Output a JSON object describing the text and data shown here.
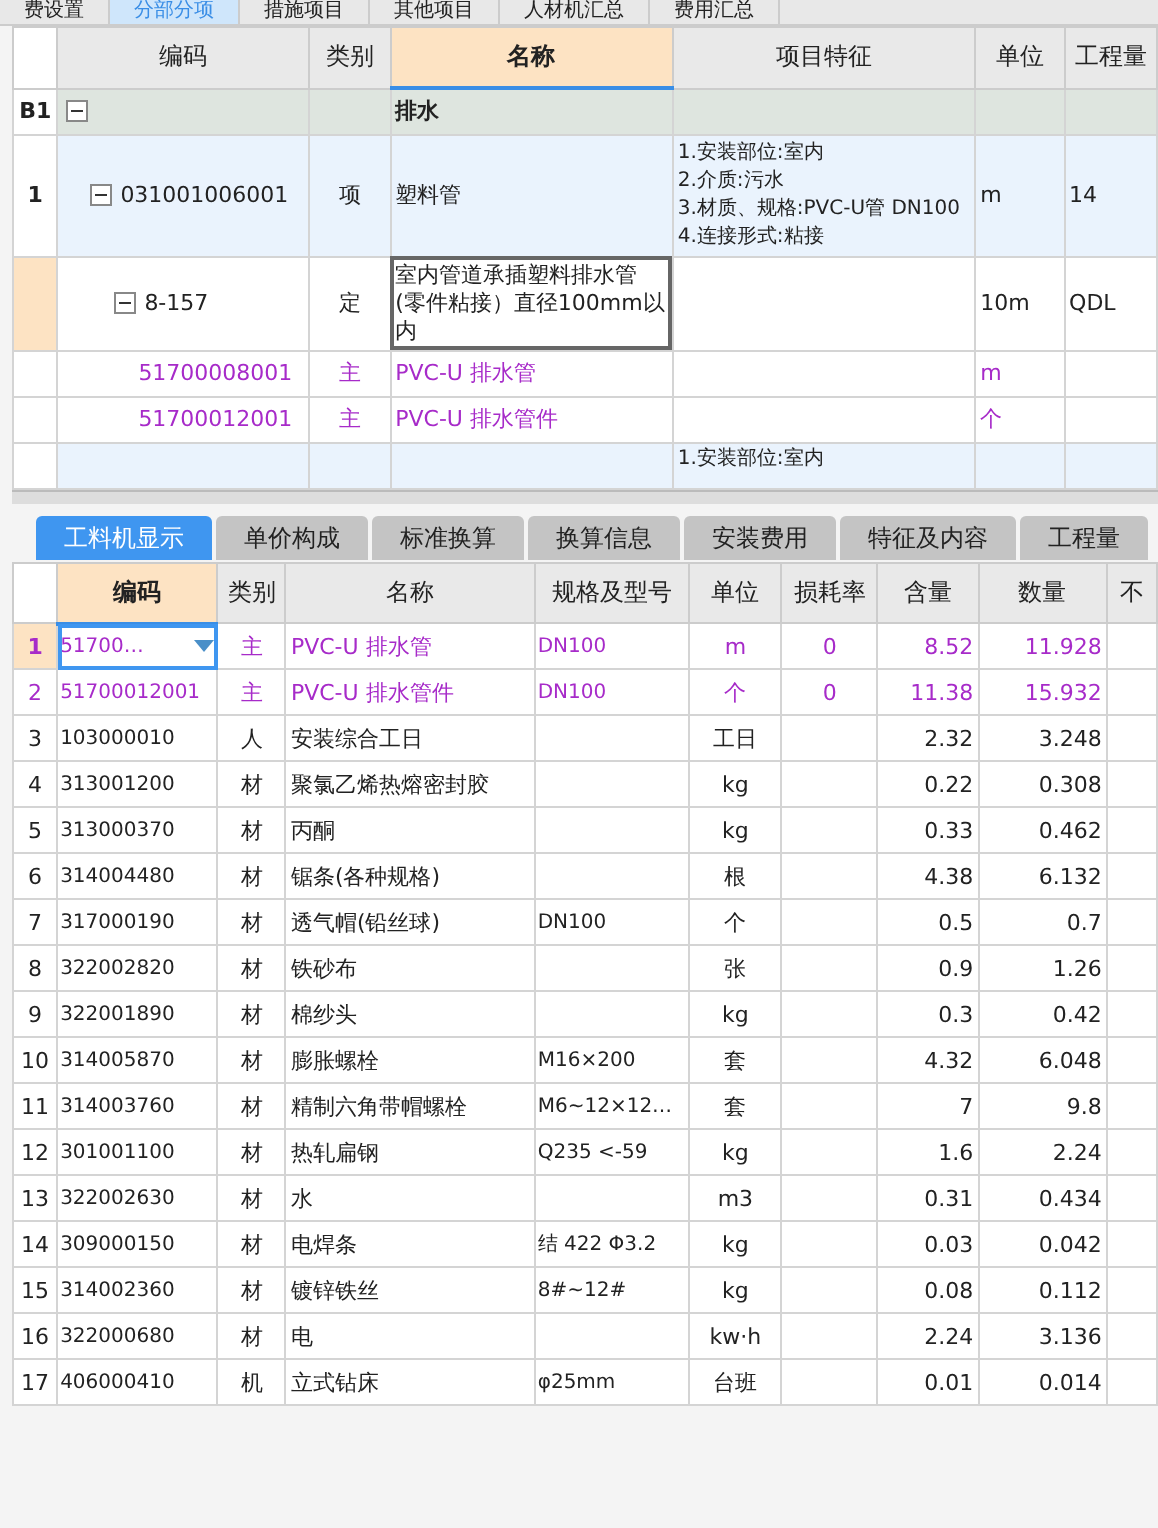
{
  "top_tabs": [
    {
      "label": "费设置",
      "selected": false
    },
    {
      "label": "分部分项",
      "selected": true
    },
    {
      "label": "措施项目",
      "selected": false
    },
    {
      "label": "其他项目",
      "selected": false
    },
    {
      "label": "人材机汇总",
      "selected": false
    },
    {
      "label": "费用汇总",
      "selected": false
    }
  ],
  "upper": {
    "columns": [
      {
        "label": "编码",
        "selected": false
      },
      {
        "label": "类别",
        "selected": false
      },
      {
        "label": "名称",
        "selected": true
      },
      {
        "label": "项目特征",
        "selected": false
      },
      {
        "label": "单位",
        "selected": false
      },
      {
        "label": "工程量",
        "selected": false
      }
    ],
    "rows": [
      {
        "row_no": "B1",
        "name": "排水",
        "kind": "section",
        "expanded": true,
        "selected": false,
        "children": [
          {
            "row_no": "1",
            "code": "031001006001",
            "type": "项",
            "name": "塑料管",
            "features": [
              "1.安装部位:室内",
              "2.介质:污水",
              "3.材质、规格:PVC-U管 DN100",
              "4.连接形式:粘接"
            ],
            "unit": "m",
            "qty": "14",
            "kind": "item",
            "expanded": true,
            "selected": false,
            "children": [
              {
                "code": "8-157",
                "type": "定",
                "name": "室内管道承插塑料排水管(零件粘接）直径100mm以内",
                "unit": "10m",
                "qty": "QDL",
                "kind": "quota",
                "expanded": true,
                "selected": true,
                "children": [
                  {
                    "code": "51700008001",
                    "type": "主",
                    "name": "PVC-U 排水管",
                    "unit": "m",
                    "kind": "main",
                    "selected": false
                  },
                  {
                    "code": "51700012001",
                    "type": "主",
                    "name": "PVC-U 排水管件",
                    "unit": "个",
                    "kind": "main",
                    "selected": false
                  }
                ]
              }
            ]
          },
          {
            "features": [
              "1.安装部位:室内"
            ],
            "kind": "partial",
            "selected": false
          }
        ]
      }
    ]
  },
  "lower_tabs": [
    {
      "label": "工料机显示",
      "selected": true
    },
    {
      "label": "单价构成",
      "selected": false
    },
    {
      "label": "标准换算",
      "selected": false
    },
    {
      "label": "换算信息",
      "selected": false
    },
    {
      "label": "安装费用",
      "selected": false
    },
    {
      "label": "特征及内容",
      "selected": false
    },
    {
      "label": "工程量",
      "selected": false
    }
  ],
  "lower": {
    "columns": [
      {
        "label": "编码",
        "selected": true
      },
      {
        "label": "类别",
        "selected": false
      },
      {
        "label": "名称",
        "selected": false
      },
      {
        "label": "规格及型号",
        "selected": false
      },
      {
        "label": "单位",
        "selected": false
      },
      {
        "label": "损耗率",
        "selected": false
      },
      {
        "label": "含量",
        "selected": false
      },
      {
        "label": "数量",
        "selected": false
      },
      {
        "label": "不",
        "selected": false
      }
    ],
    "rows": [
      {
        "no": "1",
        "code": "51700…",
        "type": "主",
        "name": "PVC-U 排水管",
        "spec": "DN100",
        "unit": "m",
        "loss": "0",
        "content": "8.52",
        "qty": "11.928",
        "kind": "main",
        "selected": true
      },
      {
        "no": "2",
        "code": "51700012001",
        "type": "主",
        "name": "PVC-U 排水管件",
        "spec": "DN100",
        "unit": "个",
        "loss": "0",
        "content": "11.38",
        "qty": "15.932",
        "kind": "main",
        "selected": false
      },
      {
        "no": "3",
        "code": "103000010",
        "type": "人",
        "name": "安装综合工日",
        "unit": "工日",
        "content": "2.32",
        "qty": "3.248",
        "kind": "normal",
        "selected": false
      },
      {
        "no": "4",
        "code": "313001200",
        "type": "材",
        "name": "聚氯乙烯热熔密封胶",
        "unit": "kg",
        "content": "0.22",
        "qty": "0.308",
        "kind": "normal",
        "selected": false
      },
      {
        "no": "5",
        "code": "313000370",
        "type": "材",
        "name": "丙酮",
        "unit": "kg",
        "content": "0.33",
        "qty": "0.462",
        "kind": "normal",
        "selected": false
      },
      {
        "no": "6",
        "code": "314004480",
        "type": "材",
        "name": "锯条(各种规格)",
        "unit": "根",
        "content": "4.38",
        "qty": "6.132",
        "kind": "normal",
        "selected": false
      },
      {
        "no": "7",
        "code": "317000190",
        "type": "材",
        "name": "透气帽(铅丝球)",
        "spec": "DN100",
        "unit": "个",
        "content": "0.5",
        "qty": "0.7",
        "kind": "normal",
        "selected": false
      },
      {
        "no": "8",
        "code": "322002820",
        "type": "材",
        "name": "铁砂布",
        "unit": "张",
        "content": "0.9",
        "qty": "1.26",
        "kind": "normal",
        "selected": false
      },
      {
        "no": "9",
        "code": "322001890",
        "type": "材",
        "name": "棉纱头",
        "unit": "kg",
        "content": "0.3",
        "qty": "0.42",
        "kind": "normal",
        "selected": false
      },
      {
        "no": "10",
        "code": "314005870",
        "type": "材",
        "name": "膨胀螺栓",
        "spec": "M16×200",
        "unit": "套",
        "content": "4.32",
        "qty": "6.048",
        "kind": "normal",
        "selected": false
      },
      {
        "no": "11",
        "code": "314003760",
        "type": "材",
        "name": "精制六角带帽螺栓",
        "spec": "M6~12×12…",
        "unit": "套",
        "content": "7",
        "qty": "9.8",
        "kind": "normal",
        "selected": false
      },
      {
        "no": "12",
        "code": "301001100",
        "type": "材",
        "name": "热轧扁钢",
        "spec": "Q235 <-59",
        "unit": "kg",
        "content": "1.6",
        "qty": "2.24",
        "kind": "normal",
        "selected": false
      },
      {
        "no": "13",
        "code": "322002630",
        "type": "材",
        "name": "水",
        "unit": "m3",
        "content": "0.31",
        "qty": "0.434",
        "kind": "normal",
        "selected": false
      },
      {
        "no": "14",
        "code": "309000150",
        "type": "材",
        "name": "电焊条",
        "spec": "结 422 Φ3.2",
        "unit": "kg",
        "content": "0.03",
        "qty": "0.042",
        "kind": "normal",
        "selected": false
      },
      {
        "no": "15",
        "code": "314002360",
        "type": "材",
        "name": "镀锌铁丝",
        "spec": "8#~12#",
        "unit": "kg",
        "content": "0.08",
        "qty": "0.112",
        "kind": "normal",
        "selected": false
      },
      {
        "no": "16",
        "code": "322000680",
        "type": "材",
        "name": "电",
        "unit": "kw·h",
        "content": "2.24",
        "qty": "3.136",
        "kind": "normal",
        "selected": false
      },
      {
        "no": "17",
        "code": "406000410",
        "type": "机",
        "name": "立式钻床",
        "spec": "φ25mm",
        "unit": "台班",
        "content": "0.01",
        "qty": "0.014",
        "kind": "normal",
        "selected": false
      }
    ]
  }
}
